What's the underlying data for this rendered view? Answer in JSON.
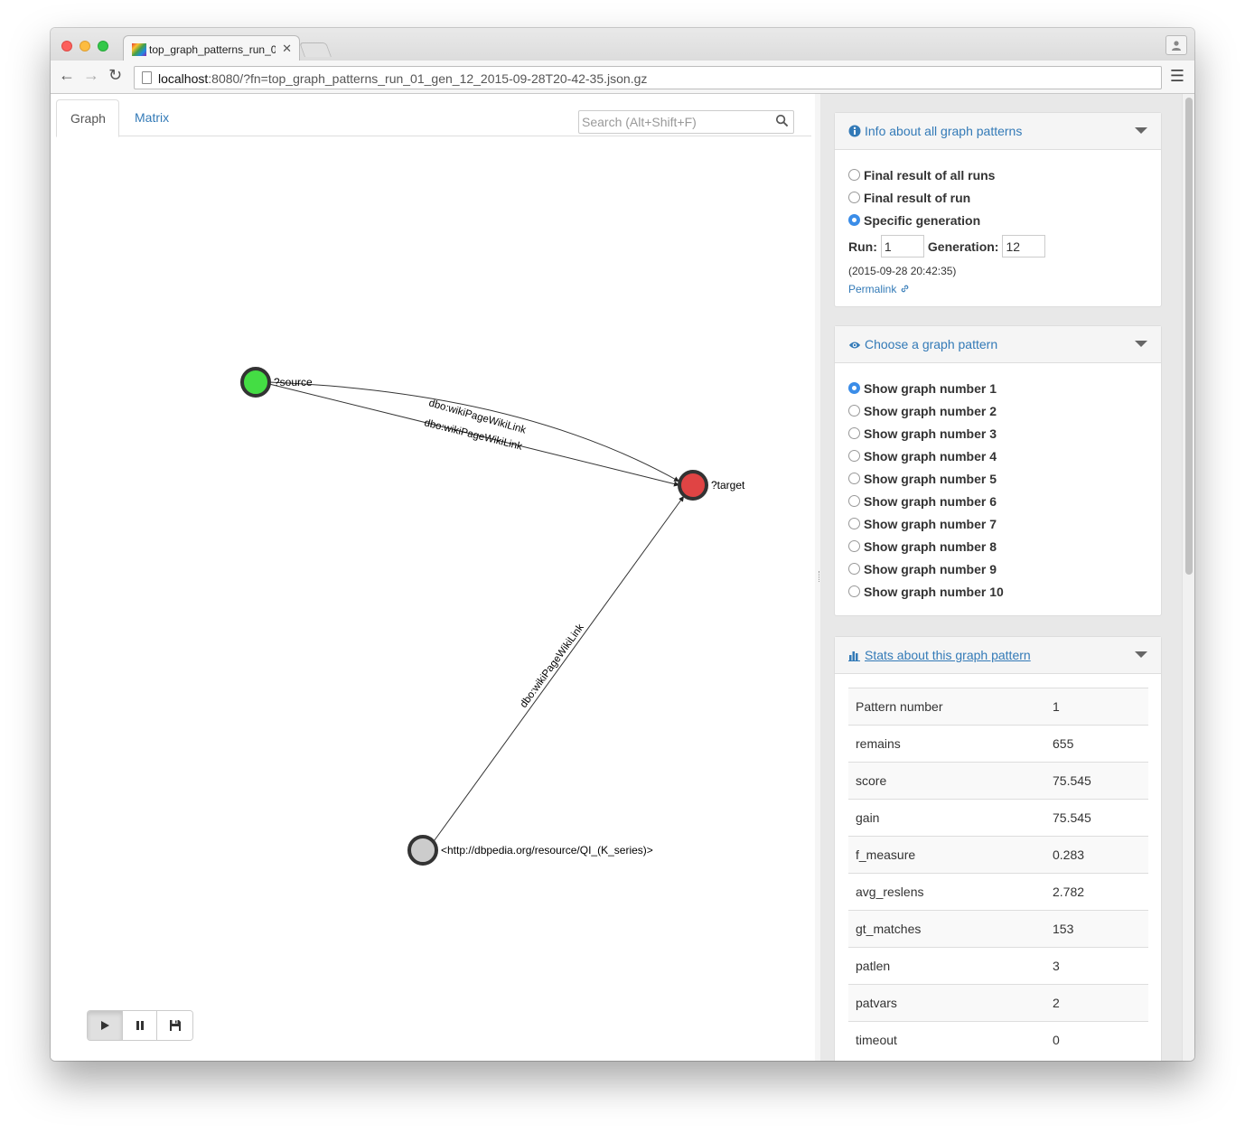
{
  "browser": {
    "tab_title": "top_graph_patterns_run_01_gen_12_2015-09-28T20-42-35.json.gz",
    "url_host": "localhost",
    "url_rest": ":8080/?fn=top_graph_patterns_run_01_gen_12_2015-09-28T20-42-35.json.gz"
  },
  "left": {
    "tabs": [
      {
        "label": "Graph",
        "active": true
      },
      {
        "label": "Matrix",
        "active": false
      }
    ],
    "search": {
      "placeholder": "Search (Alt+Shift+F)",
      "value": ""
    }
  },
  "graph": {
    "nodes": [
      {
        "id": "source",
        "label": "?source",
        "color": "#44dd44"
      },
      {
        "id": "target",
        "label": "?target",
        "color": "#e04444"
      },
      {
        "id": "qi",
        "label": "<http://dbpedia.org/resource/QI_(K_series)>",
        "color": "#cccccc"
      }
    ],
    "edges": [
      {
        "from": "source",
        "to": "target",
        "label": "dbo:wikiPageWikiLink"
      },
      {
        "from": "source",
        "to": "target",
        "label": "dbo:wikiPageWikiLink"
      },
      {
        "from": "qi",
        "to": "target",
        "label": "dbo:wikiPageWikiLink"
      }
    ]
  },
  "player": {
    "buttons": [
      "play-icon",
      "pause-icon",
      "save-icon"
    ],
    "active": "play-icon"
  },
  "info_panel": {
    "title": "Info about all graph patterns",
    "icon": "info-icon",
    "options": [
      {
        "label": "Final result of all runs",
        "checked": false
      },
      {
        "label": "Final result of run",
        "checked": false
      },
      {
        "label": "Specific generation",
        "checked": true
      }
    ],
    "run_label": "Run:",
    "run_value": "1",
    "generation_label": "Generation:",
    "generation_value": "12",
    "timestamp": "(2015-09-28 20:42:35)",
    "permalink": "Permalink"
  },
  "choose_panel": {
    "title": "Choose a graph pattern",
    "icon": "eye-icon",
    "options": [
      {
        "label": "Show graph number 1",
        "checked": true
      },
      {
        "label": "Show graph number 2",
        "checked": false
      },
      {
        "label": "Show graph number 3",
        "checked": false
      },
      {
        "label": "Show graph number 4",
        "checked": false
      },
      {
        "label": "Show graph number 5",
        "checked": false
      },
      {
        "label": "Show graph number 6",
        "checked": false
      },
      {
        "label": "Show graph number 7",
        "checked": false
      },
      {
        "label": "Show graph number 8",
        "checked": false
      },
      {
        "label": "Show graph number 9",
        "checked": false
      },
      {
        "label": "Show graph number 10",
        "checked": false
      }
    ]
  },
  "stats_panel": {
    "title": "Stats about this graph pattern",
    "icon": "bar-chart-icon",
    "rows": [
      [
        "Pattern number",
        "1"
      ],
      [
        "remains",
        "655"
      ],
      [
        "score",
        "75.545"
      ],
      [
        "gain",
        "75.545"
      ],
      [
        "f_measure",
        "0.283"
      ],
      [
        "avg_reslens",
        "2.782"
      ],
      [
        "gt_matches",
        "153"
      ],
      [
        "patlen",
        "3"
      ],
      [
        "patvars",
        "2"
      ],
      [
        "timeout",
        "0"
      ]
    ]
  },
  "colors": {
    "link": "#337ab7",
    "radio_checked": "#3b8de8",
    "node_source": "#44dd44",
    "node_target": "#e04444",
    "node_resource": "#cccccc"
  }
}
